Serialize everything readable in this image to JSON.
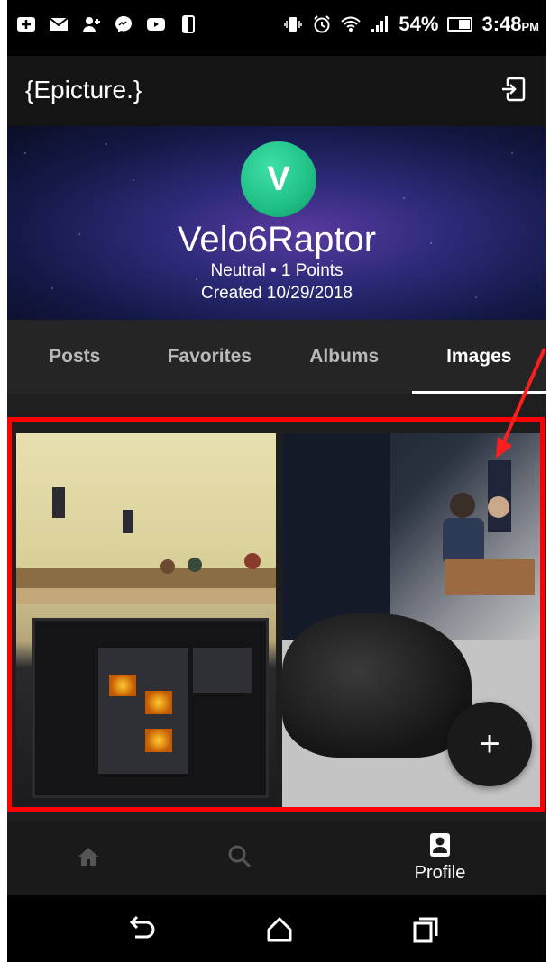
{
  "status_bar": {
    "battery_percent": "54%",
    "battery_level": 0.54,
    "time": "3:48",
    "ampm": "PM",
    "icons": [
      "plus-icon",
      "mail-icon",
      "person-add-icon",
      "messenger-icon",
      "youtube-icon",
      "phone-icon",
      "vibrate-icon",
      "alarm-icon",
      "wifi-icon",
      "signal-icon",
      "battery-icon"
    ]
  },
  "app": {
    "title": "{Epicture.}",
    "logout_icon": "logout-icon"
  },
  "profile": {
    "avatar_letter": "V",
    "username": "Velo6Raptor",
    "reputation": "Neutral • 1 Points",
    "created": "Created 10/29/2018",
    "colors": {
      "avatar": "#1fbf85"
    }
  },
  "tabs": [
    {
      "label": "Posts",
      "active": false
    },
    {
      "label": "Favorites",
      "active": false
    },
    {
      "label": "Albums",
      "active": false
    },
    {
      "label": "Images",
      "active": true
    }
  ],
  "fab": {
    "label": "+"
  },
  "bottom_nav": {
    "home_icon": "home-icon",
    "search_icon": "search-icon",
    "profile_icon": "profile-icon",
    "profile_label": "Profile"
  },
  "system_nav": [
    "back-icon",
    "home-outline-icon",
    "recents-icon"
  ],
  "annotation": {
    "highlight_color": "#ff0000"
  }
}
